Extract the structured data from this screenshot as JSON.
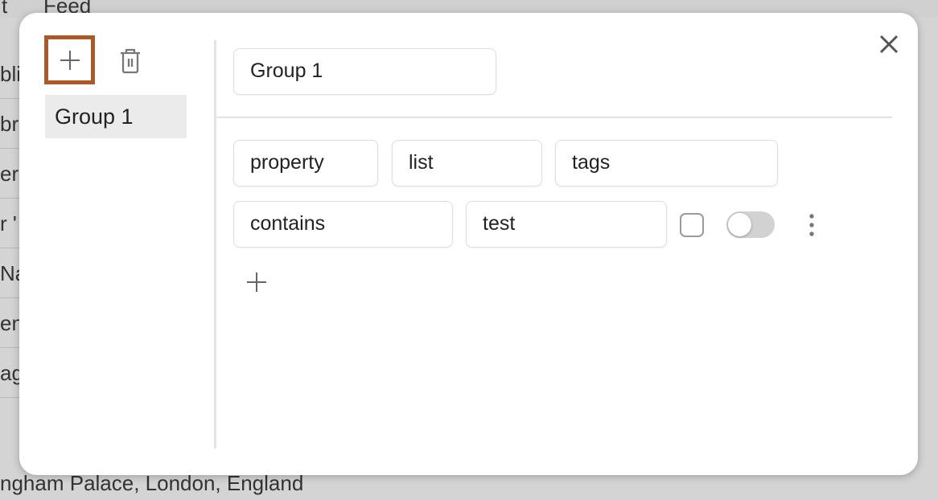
{
  "background": {
    "header_cells": [
      "t",
      "Feed"
    ],
    "row_fragments": [
      "bli",
      "br",
      "erc",
      "r '",
      "Na",
      "en,",
      "ag"
    ],
    "bottom_text": "ngham Palace, London, England"
  },
  "modal": {
    "sidebar": {
      "add_icon": "plus-icon",
      "delete_icon": "trash-icon",
      "groups": [
        {
          "label": "Group 1",
          "selected": true
        }
      ]
    },
    "group_name": "Group 1",
    "rule": {
      "field1": "property",
      "field2": "list",
      "field3": "tags",
      "operator": "contains",
      "value": "test",
      "checkbox_checked": false,
      "toggle_on": false
    },
    "close_icon": "close-icon",
    "more_icon": "vertical-ellipsis-icon",
    "add_rule_icon": "plus-icon",
    "accent": "#a85a2c"
  }
}
